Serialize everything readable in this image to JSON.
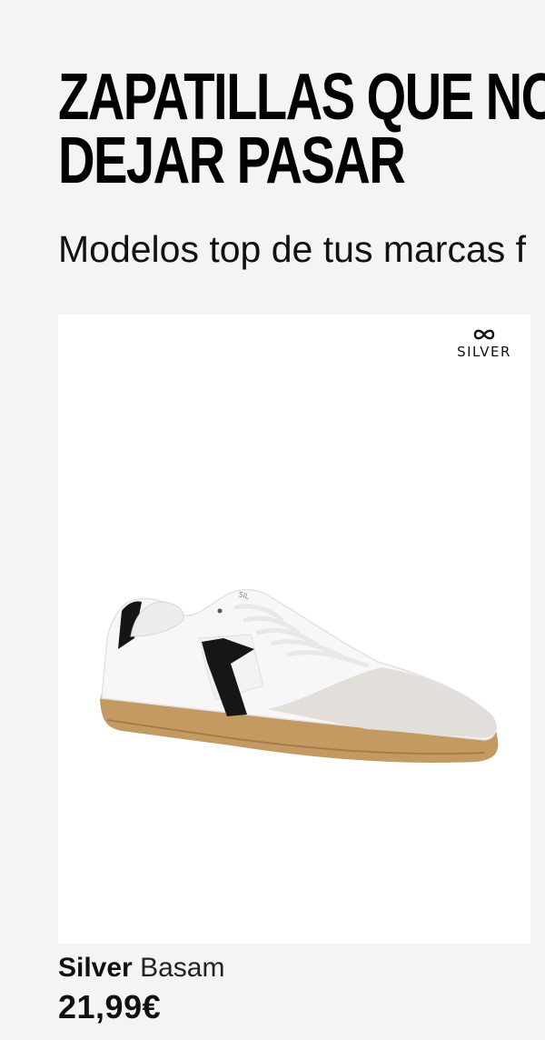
{
  "section": {
    "title_line1": "ZAPATILLAS QUE NO",
    "title_line2": "DEJAR PASAR",
    "subtitle": "Modelos top de tus marcas f"
  },
  "product": {
    "brand_logo_text": "SILVER",
    "brand_logo_icon": "silver-infinity-logo",
    "brand": "Silver",
    "model": "Basam",
    "price": "21,99€",
    "image": "white-black-sneaker-gum-sole"
  },
  "colors": {
    "background": "#f4f4f4",
    "card": "#ffffff",
    "text": "#111111"
  }
}
